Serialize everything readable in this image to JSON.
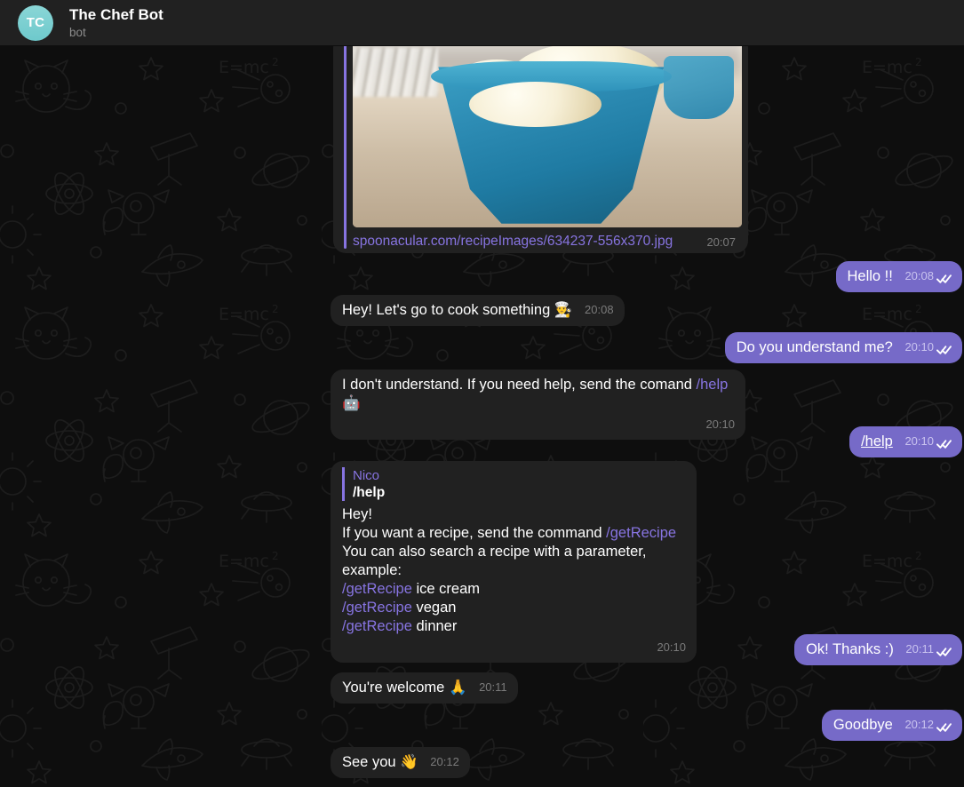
{
  "header": {
    "avatar_initials": "TC",
    "title": "The Chef Bot",
    "status": "bot"
  },
  "chat": {
    "image_message": {
      "url_label": "spoonacular.com/recipeImages/634237-556x370.jpg",
      "time": "20:07",
      "photo_alt": "Scoops of vanilla ice cream in a blue ceramic bowl"
    },
    "messages": [
      {
        "id": "m1",
        "side": "out",
        "text": "Hello !!",
        "time": "20:08",
        "status": "read"
      },
      {
        "id": "m2",
        "side": "in",
        "text": "Hey! Let's go to cook something 👨‍🍳",
        "time": "20:08"
      },
      {
        "id": "m3",
        "side": "out",
        "text": "Do you understand me?",
        "time": "20:10",
        "status": "read"
      },
      {
        "id": "m4",
        "side": "in",
        "text_before": "I don't understand. If you need help, send the comand ",
        "command": "/help",
        "text_after": " 🤖",
        "time": "20:10"
      },
      {
        "id": "m5",
        "side": "out",
        "text": "/help",
        "time": "20:10",
        "status": "read",
        "underline": true
      },
      {
        "id": "m6",
        "side": "in",
        "type": "help",
        "time": "20:10"
      },
      {
        "id": "m7",
        "side": "out",
        "text": "Ok! Thanks :)",
        "time": "20:11",
        "status": "read"
      },
      {
        "id": "m8",
        "side": "in",
        "text": "You're welcome 🙏",
        "time": "20:11"
      },
      {
        "id": "m9",
        "side": "out",
        "text": "Goodbye",
        "time": "20:12",
        "status": "read"
      },
      {
        "id": "m10",
        "side": "in",
        "text": "See you 👋",
        "time": "20:12"
      }
    ],
    "help_message": {
      "quote_author": "Nico",
      "quote_text": "/help",
      "line1": "Hey!",
      "line2_before": "If you want a recipe, send the command ",
      "line2_command": "/getRecipe",
      "line3": "You can also search a recipe with a parameter, example:",
      "examples": [
        {
          "command": "/getRecipe",
          "arg": " ice cream"
        },
        {
          "command": "/getRecipe",
          "arg": " vegan"
        },
        {
          "command": "/getRecipe",
          "arg": " dinner"
        }
      ],
      "time": "20:10"
    }
  },
  "colors": {
    "outgoing_bubble": "#766ac8",
    "incoming_bubble": "#212121",
    "command_link": "#8774e1",
    "avatar": "#7ed0d2",
    "background": "#0e0e0e"
  }
}
